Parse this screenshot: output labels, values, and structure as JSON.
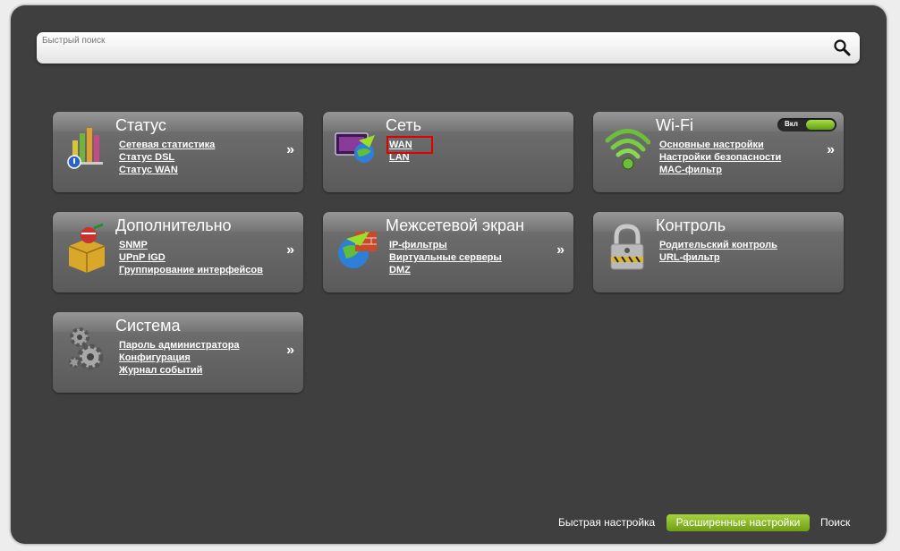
{
  "search": {
    "placeholder": "Быстрый поиск",
    "icon": "magnifier-icon"
  },
  "tiles": {
    "status": {
      "title": "Статус",
      "icon": "status-chart-icon",
      "links": [
        "Сетевая статистика",
        "Статус DSL",
        "Статус WAN"
      ],
      "arrow": "»"
    },
    "network": {
      "title": "Сеть",
      "icon": "network-globe-icon",
      "links": [
        "WAN",
        "LAN"
      ],
      "highlighted": "WAN"
    },
    "wifi": {
      "title": "Wi-Fi",
      "icon": "wifi-icon",
      "toggle_label": "Вкл",
      "links": [
        "Основные настройки",
        "Настройки безопасности",
        "MAC-фильтр"
      ],
      "arrow": "»"
    },
    "advanced": {
      "title": "Дополнительно",
      "icon": "advanced-box-icon",
      "links": [
        "SNMP",
        "UPnP IGD",
        "Группирование интерфейсов"
      ],
      "arrow": "»"
    },
    "firewall": {
      "title": "Межсетевой экран",
      "icon": "firewall-globe-icon",
      "links": [
        "IP-фильтры",
        "Виртуальные серверы",
        "DMZ"
      ],
      "arrow": "»"
    },
    "control": {
      "title": "Контроль",
      "icon": "padlock-icon",
      "links": [
        "Родительский контроль",
        "URL-фильтр"
      ]
    },
    "system": {
      "title": "Система",
      "icon": "gears-icon",
      "links": [
        "Пароль администратора",
        "Конфигурация",
        "Журнал событий"
      ],
      "arrow": "»"
    }
  },
  "footer": {
    "quick_setup": "Быстрая настройка",
    "advanced_settings": "Расширенные настройки",
    "search": "Поиск"
  },
  "colors": {
    "background": "#3f3f3f",
    "tile": "#6b6b6b",
    "accent_green": "#8bc12a",
    "highlight": "#e00000"
  }
}
